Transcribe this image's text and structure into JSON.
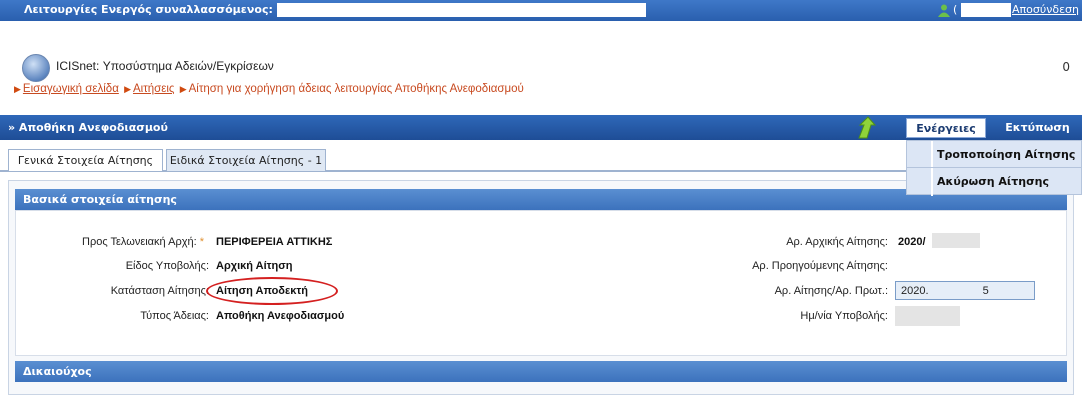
{
  "topbar": {
    "title": "Λειτουργίες  Ενεργός συναλλασσόμενος:",
    "user_paren": "(",
    "logout_label": "Αποσύνδεση"
  },
  "header": {
    "app_title": "ICISnet: Υποσύστημα Αδειών/Εγκρίσεων",
    "right_value": "0",
    "breadcrumb": {
      "home": "Εισαγωγική σελίδα",
      "requests": "Αιτήσεις",
      "current": "Αίτηση για χορήγηση άδειας λειτουργίας Αποθήκης Ανεφοδιασμού"
    }
  },
  "section": {
    "title": "» Αποθήκη Ανεφοδιασμού",
    "actions_label": "Ενέργειες",
    "print_label": "Εκτύπωση"
  },
  "tabs": [
    {
      "label": "Γενικά Στοιχεία Αίτησης",
      "active": true
    },
    {
      "label": "Ειδικά Στοιχεία Αίτησης - 1",
      "active": false
    }
  ],
  "actions_menu": [
    {
      "label": "Τροποποίηση Αίτησης"
    },
    {
      "label": "Ακύρωση Αίτησης"
    }
  ],
  "basic_panel": {
    "title": "Βασικά στοιχεία αίτησης",
    "left": {
      "authority_label": "Προς Τελωνειακή Αρχή:",
      "required_mark": "*",
      "authority_value": "ΠΕΡΙΦΕΡΕΙΑ ΑΤΤΙΚΗΣ",
      "submission_type_label": "Είδος Υποβολής:",
      "submission_type_value": "Αρχική Αίτηση",
      "status_label": "Κατάσταση Αίτησης:",
      "status_value": "Αίτηση Αποδεκτή",
      "license_type_label": "Τύπος Άδειας:",
      "license_type_value": "Αποθήκη Ανεφοδιασμού"
    },
    "right": {
      "initial_no_label": "Αρ. Αρχικής Αίτησης:",
      "initial_no_value": "2020/",
      "previous_no_label": "Αρ. Προηγούμενης Αίτησης:",
      "request_no_label": "Αρ. Αίτησης/Αρ. Πρωτ.:",
      "request_no_value": "2020.",
      "request_no_suffix": "5",
      "submit_date_label": "Ημ/νία Υποβολής:"
    }
  },
  "holder_panel": {
    "title": "Δικαιούχος"
  },
  "colors": {
    "topbar": "#2f68b9",
    "breadcrumb": "#c84a20",
    "highlight_oval": "#d42020",
    "required": "#e09030"
  }
}
